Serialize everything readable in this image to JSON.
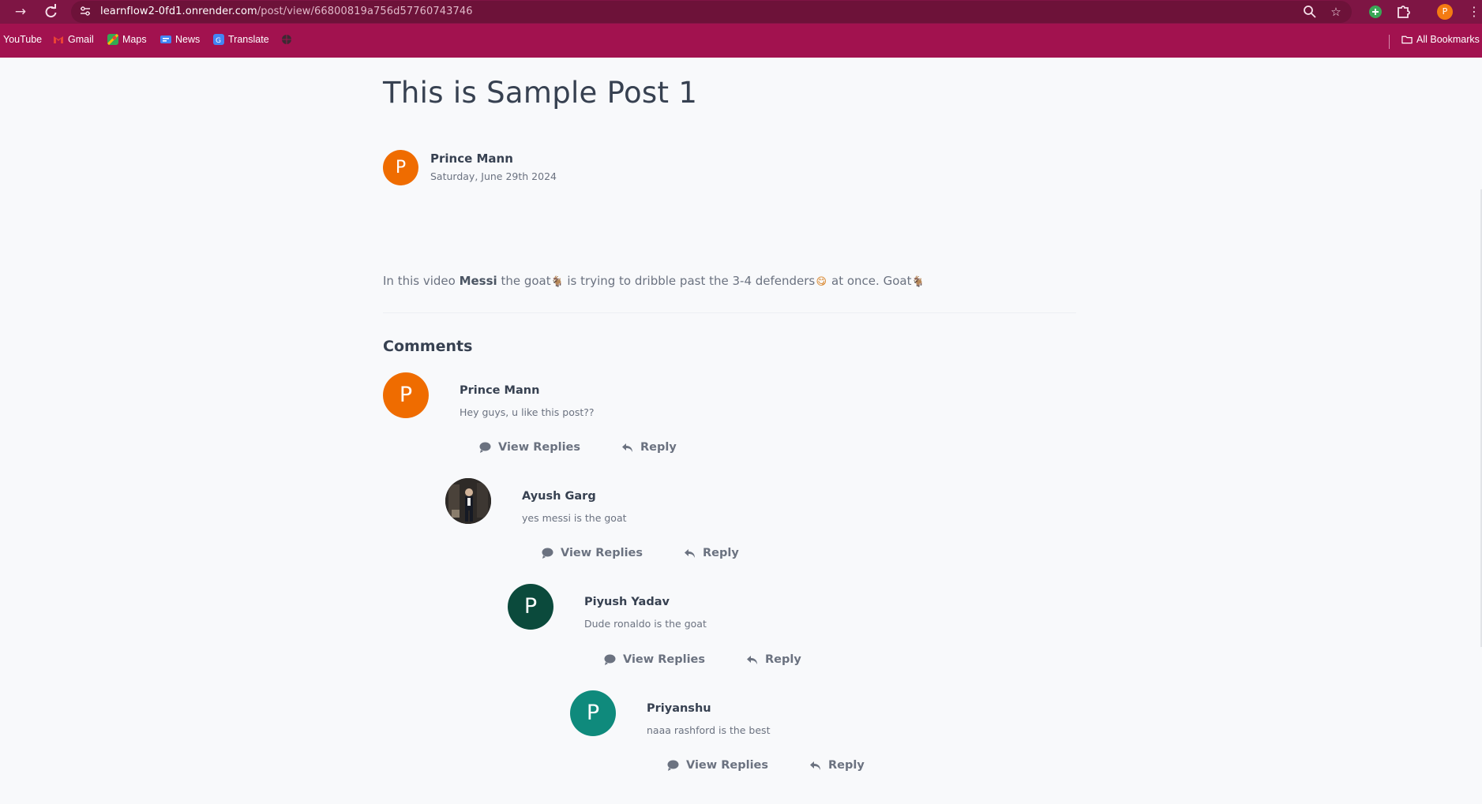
{
  "browser": {
    "url_host": "learnflow2-0fd1.onrender.com",
    "url_path": "/post/view/66800819a756d57760743746",
    "profile_initial": "P",
    "bookmarks": [
      {
        "label": "YouTube"
      },
      {
        "label": "Gmail"
      },
      {
        "label": "Maps"
      },
      {
        "label": "News"
      },
      {
        "label": "Translate"
      }
    ],
    "all_bookmarks_label": "All Bookmarks"
  },
  "post": {
    "title": "This is Sample Post 1",
    "author": {
      "name": "Prince Mann",
      "initial": "P",
      "color": "#ef6c00"
    },
    "date": "Saturday, June 29th 2024",
    "body_before": "In this video ",
    "body_bold": "Messi",
    "body_mid": " the goat",
    "body_mid2": " is trying to dribble past the 3-4 defenders",
    "body_mid3": " at once. Goat",
    "emoji_goat": "🐐",
    "emoji_face": "😋"
  },
  "comments": {
    "heading": "Comments",
    "view_replies_label": "View Replies",
    "reply_label": "Reply",
    "items": [
      {
        "name": "Prince Mann",
        "text": "Hey guys, u like this post??",
        "initial": "P",
        "color": "#ef6c00"
      },
      {
        "name": "Ayush Garg",
        "text": "yes messi is the goat",
        "initial": "",
        "color": "#3a3a3a"
      },
      {
        "name": "Piyush Yadav",
        "text": "Dude ronaldo is the goat",
        "initial": "P",
        "color": "#0b4a3c"
      },
      {
        "name": "Priyanshu",
        "text": "naaa rashford is the best",
        "initial": "P",
        "color": "#0f8a7c"
      }
    ]
  }
}
